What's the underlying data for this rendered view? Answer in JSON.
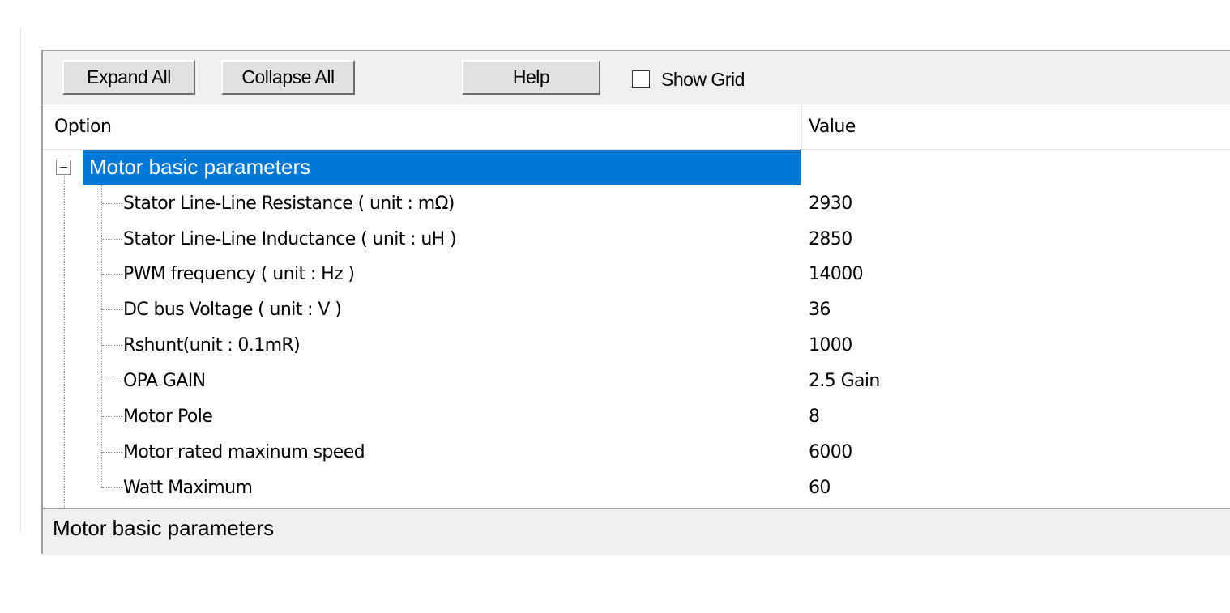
{
  "toolbar": {
    "expand_all_label": "Expand All",
    "collapse_all_label": "Collapse All",
    "help_label": "Help",
    "show_grid_label": "Show Grid",
    "show_grid_checked": false
  },
  "grid": {
    "columns": {
      "option": "Option",
      "value": "Value"
    },
    "group": {
      "label": "Motor basic parameters",
      "expanded": true,
      "selected": true
    },
    "rows": [
      {
        "label": "Stator Line-Line Resistance ( unit : mΩ)",
        "value": "2930"
      },
      {
        "label": "Stator Line-Line Inductance ( unit : uH )",
        "value": "2850"
      },
      {
        "label": "PWM frequency ( unit : Hz )",
        "value": "14000"
      },
      {
        "label": "DC bus Voltage ( unit : V )",
        "value": "36"
      },
      {
        "label": "Rshunt(unit : 0.1mR)",
        "value": "1000"
      },
      {
        "label": "OPA GAIN",
        "value": "2.5 Gain"
      },
      {
        "label": "Motor Pole",
        "value": "8"
      },
      {
        "label": "Motor rated maxinum speed",
        "value": "6000"
      },
      {
        "label": "Watt Maximum",
        "value": "60"
      }
    ]
  },
  "status": {
    "description": "Motor basic parameters"
  },
  "colors": {
    "selection": "#0078d7",
    "panel_bg": "#f0f0f0",
    "button_bg": "#e1e1e1"
  }
}
